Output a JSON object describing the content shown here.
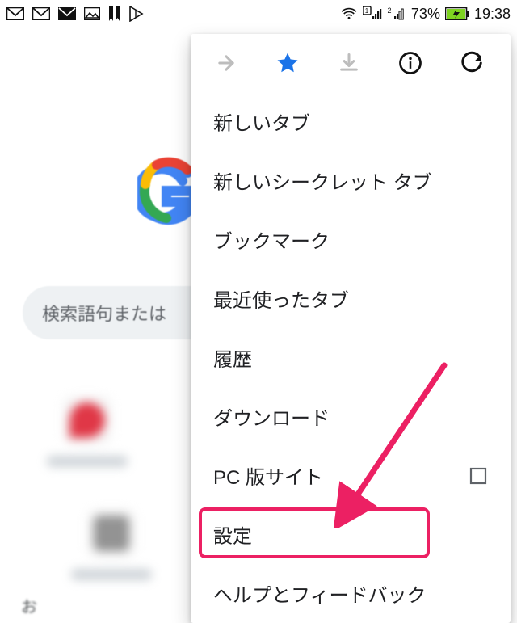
{
  "status": {
    "battery_text": "73%",
    "time": "19:38"
  },
  "search": {
    "placeholder": "検索語句または"
  },
  "bottom_hint": "お",
  "menu": {
    "items": [
      {
        "label": "新しいタブ"
      },
      {
        "label": "新しいシークレット タブ"
      },
      {
        "label": "ブックマーク"
      },
      {
        "label": "最近使ったタブ"
      },
      {
        "label": "履歴"
      },
      {
        "label": "ダウンロード"
      },
      {
        "label": "PC 版サイト",
        "checkbox": true
      },
      {
        "label": "設定",
        "highlight": true
      },
      {
        "label": "ヘルプとフィードバック"
      }
    ]
  },
  "colors": {
    "accent": "#ec2063",
    "star_active": "#1a73e8"
  }
}
